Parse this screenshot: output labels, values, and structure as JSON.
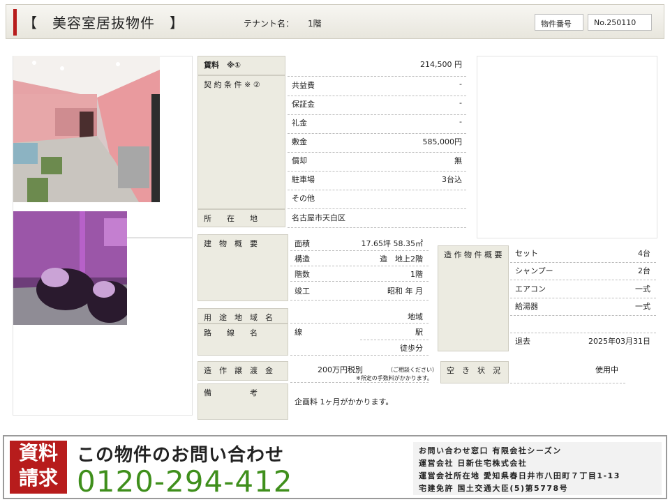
{
  "header": {
    "title": "【　美容室居抜物件　】",
    "tenant_label": "テナント名：",
    "tenant_value": "1階",
    "property_no_label": "物件番号",
    "property_no_value": "No.250110"
  },
  "rent": {
    "label": "賃料　※①",
    "value": "214,500 円"
  },
  "contract": {
    "label": "契 約 条 件 ※ ②",
    "items": [
      {
        "name": "共益費",
        "value": "-"
      },
      {
        "name": "保証金",
        "value": "-"
      },
      {
        "name": "礼金",
        "value": "-"
      },
      {
        "name": "敷金",
        "value": "585,000円"
      },
      {
        "name": "償却",
        "value": "無"
      },
      {
        "name": "駐車場",
        "value": "3台込"
      },
      {
        "name": "その他",
        "value": ""
      }
    ]
  },
  "location": {
    "label": "所　　在　　地",
    "value": "名古屋市天白区"
  },
  "building": {
    "label": "建　物　概　要",
    "items": [
      {
        "name": "面積",
        "value": "17.65坪 58.35㎡"
      },
      {
        "name": "構造",
        "value": "造　地上2階"
      },
      {
        "name": "階数",
        "value": "1階"
      },
      {
        "name": "竣工",
        "value": "昭和 年 月"
      }
    ]
  },
  "zoning": {
    "label": "用　途　地　域　名",
    "value": "地域"
  },
  "route": {
    "label": "路　　線　　名",
    "line": "線",
    "station": "駅",
    "walk": "徒歩分"
  },
  "fixtures": {
    "label": "造 作 物 件 概 要",
    "items": [
      {
        "name": "セット",
        "value": "4台"
      },
      {
        "name": "シャンプー",
        "value": "2台"
      },
      {
        "name": "エアコン",
        "value": "一式"
      },
      {
        "name": "給湯器",
        "value": "一式"
      },
      {
        "name": "",
        "value": ""
      },
      {
        "name": "退去",
        "value": "2025年03月31日"
      }
    ]
  },
  "transfer": {
    "label": "造　作　譲　渡　金",
    "value": "200万円税別",
    "note1": "（ご相談ください）",
    "note2": "※所定の手数料がかかります。"
  },
  "vacancy": {
    "label": "空　き　状　況",
    "value": "使用中"
  },
  "remarks": {
    "label": "備　　　　　考",
    "value": "企画料 1ヶ月がかかります。"
  },
  "footer": {
    "badge_line1": "資料",
    "badge_line2": "請求",
    "inquiry": "この物件のお問い合わせ",
    "phone": "0120-294-412",
    "company_lines": [
      "お問い合わせ窓口 有限会社シーズン",
      "運営会社 日新住宅株式会社",
      "運営会社所在地 愛知県春日井市八田町７丁目1-13",
      "宅建免許 国土交通大臣(5)第5778号"
    ]
  },
  "colors": {
    "accent": "#b71c1c",
    "label_bg": "#ecebe1",
    "phone": "#3f8f1c"
  }
}
